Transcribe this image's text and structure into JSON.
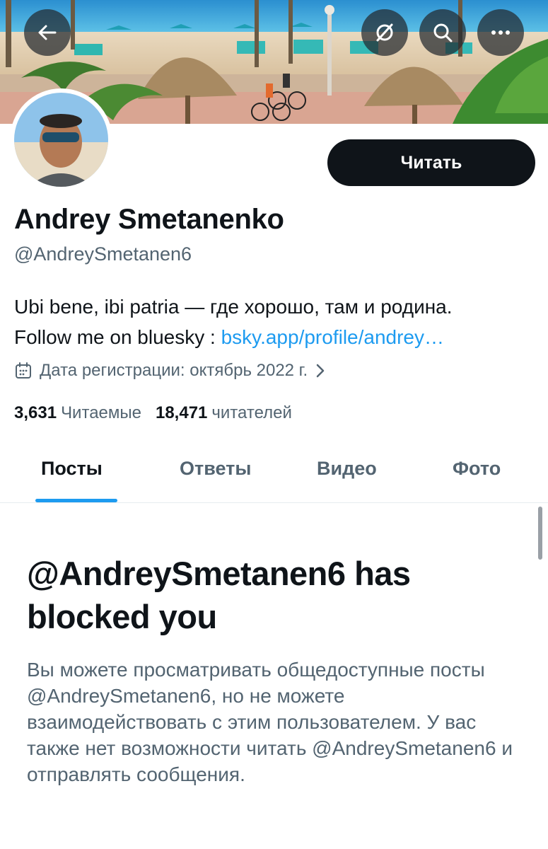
{
  "header": {
    "back_icon": "arrow-left-icon",
    "refresh_icon": "refresh-slash-icon",
    "search_icon": "search-icon",
    "more_icon": "more-horizontal-icon"
  },
  "profile": {
    "name": "Andrey Smetanenko",
    "handle": "@AndreySmetanen6",
    "follow_label": "Читать",
    "bio_line1": "Ubi bene, ibi patria — где хорошо, там и родина.",
    "bio_line2_prefix": "Follow me on bluesky : ",
    "bio_link": "bsky.app/profile/andrey…",
    "joined": "Дата регистрации: октябрь 2022 г.",
    "following_count": "3,631",
    "following_label": "Читаемые",
    "followers_count": "18,471",
    "followers_label": "читателей"
  },
  "tabs": [
    {
      "label": "Посты",
      "active": true
    },
    {
      "label": "Ответы",
      "active": false
    },
    {
      "label": "Видео",
      "active": false
    },
    {
      "label": "Фото",
      "active": false
    }
  ],
  "blocked": {
    "title": "@AndreySmetanen6 has blocked you",
    "message": "Вы можете просматривать общедоступные посты @AndreySmetanen6, но не можете взаимодействовать с этим пользователем. У вас также нет возможности читать @AndreySmetanen6 и отправлять сообщения."
  },
  "colors": {
    "accent": "#1d9bf0",
    "text_primary": "#0f1419",
    "text_secondary": "#536471",
    "button_dark": "#0f1419"
  }
}
